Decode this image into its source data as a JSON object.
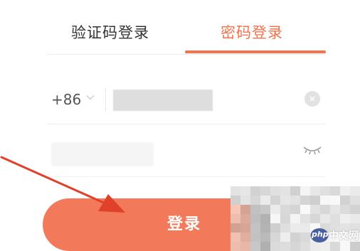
{
  "tabs": {
    "sms_login": "验证码登录",
    "password_login": "密码登录",
    "active": "password_login"
  },
  "phone": {
    "country_code": "+86",
    "value": ""
  },
  "password": {
    "value": ""
  },
  "login_button": {
    "label": "登录"
  },
  "watermark": {
    "badge": "php",
    "site": "中文网"
  },
  "colors": {
    "accent": "#f4724c",
    "button": "#f27a5a",
    "arrow": "#e0412a",
    "text_dark": "#333333"
  },
  "icons": {
    "chevron": "chevron-down-icon",
    "clear": "clear-icon",
    "eye": "eye-closed-icon",
    "annotation": "arrow-icon"
  }
}
